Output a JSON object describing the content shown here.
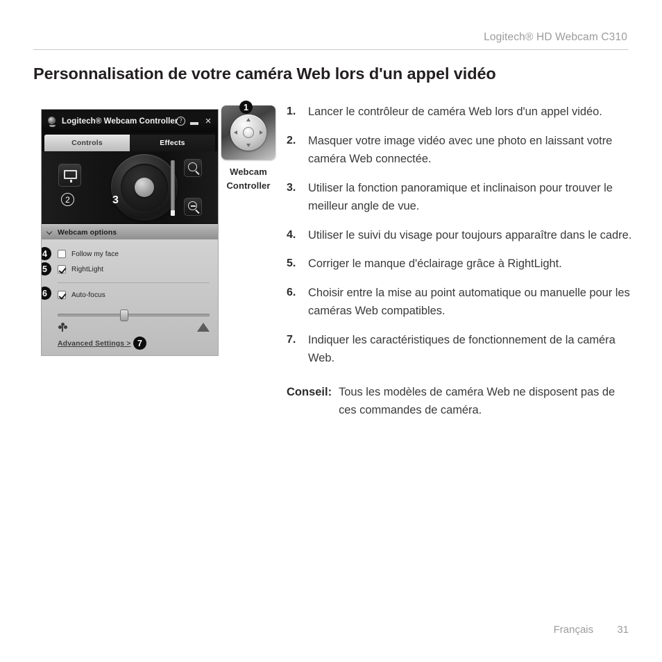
{
  "header": {
    "product_title": "Logitech® HD Webcam C310"
  },
  "page_title": "Personnalisation de votre caméra Web lors d'un appel vidéo",
  "software_window": {
    "titlebar": {
      "app_icon": "webcam-icon",
      "title": "Logitech® Webcam Controller",
      "help_label": "?",
      "minimize_label": "_",
      "close_label": "×"
    },
    "tabs": [
      {
        "label": "Controls",
        "active": true
      },
      {
        "label": "Effects",
        "active": false
      }
    ],
    "controls": {
      "monitor_button_icon": "monitor-icon",
      "pan_tilt_wheel_icon": "pan-tilt-wheel-icon",
      "zoom_in_icon": "magnifier-plus-icon",
      "zoom_out_icon": "magnifier-minus-icon",
      "zoom_slider_value": 0
    },
    "options_section": {
      "title": "Webcam options",
      "collapse_icon": "chevron-down-icon",
      "items": [
        {
          "label": "Follow my face",
          "checked": false
        },
        {
          "label": "RightLight",
          "checked": true
        },
        {
          "label": "Auto-focus",
          "checked": true
        }
      ],
      "focus_slider": {
        "value_percent": 41,
        "min_icon": "flower-macro-icon",
        "max_icon": "mountain-infinity-icon"
      },
      "advanced_link": "Advanced Settings >"
    }
  },
  "callouts": {
    "one": "1",
    "two": "2",
    "three": "3",
    "four": "4",
    "five": "5",
    "six": "6",
    "seven": "7"
  },
  "app_icon": {
    "label_line1": "Webcam",
    "label_line2": "Controller",
    "icon": "webcam-controller-dpad-icon"
  },
  "instructions": [
    {
      "num": "1.",
      "text": "Lancer le contrôleur de caméra Web lors d'un appel vidéo."
    },
    {
      "num": "2.",
      "text": "Masquer votre image vidéo avec une photo en laissant votre caméra Web connectée."
    },
    {
      "num": "3.",
      "text": "Utiliser la fonction panoramique et inclinaison pour trouver le meilleur angle de vue."
    },
    {
      "num": "4.",
      "text": "Utiliser le suivi du visage pour toujours apparaître dans le cadre."
    },
    {
      "num": "5.",
      "text": "Corriger le manque d'éclairage grâce à RightLight."
    },
    {
      "num": "6.",
      "text": "Choisir entre la mise au point automatique ou manuelle pour les caméras Web compatibles."
    },
    {
      "num": "7.",
      "text": "Indiquer les caractéristiques de fonctionnement de la caméra Web."
    }
  ],
  "tip": {
    "label": "Conseil:",
    "text": "Tous les modèles de caméra Web ne disposent pas de ces commandes de caméra."
  },
  "footer": {
    "language": "Français",
    "page_number": "31"
  },
  "colors": {
    "header_text": "#9b9b9b",
    "title_text": "#231f20",
    "body_text": "#3a3a3a",
    "callout_bg": "#0d0d0d",
    "panel_dark": "#111111",
    "panel_light": "#c8c8c8"
  }
}
